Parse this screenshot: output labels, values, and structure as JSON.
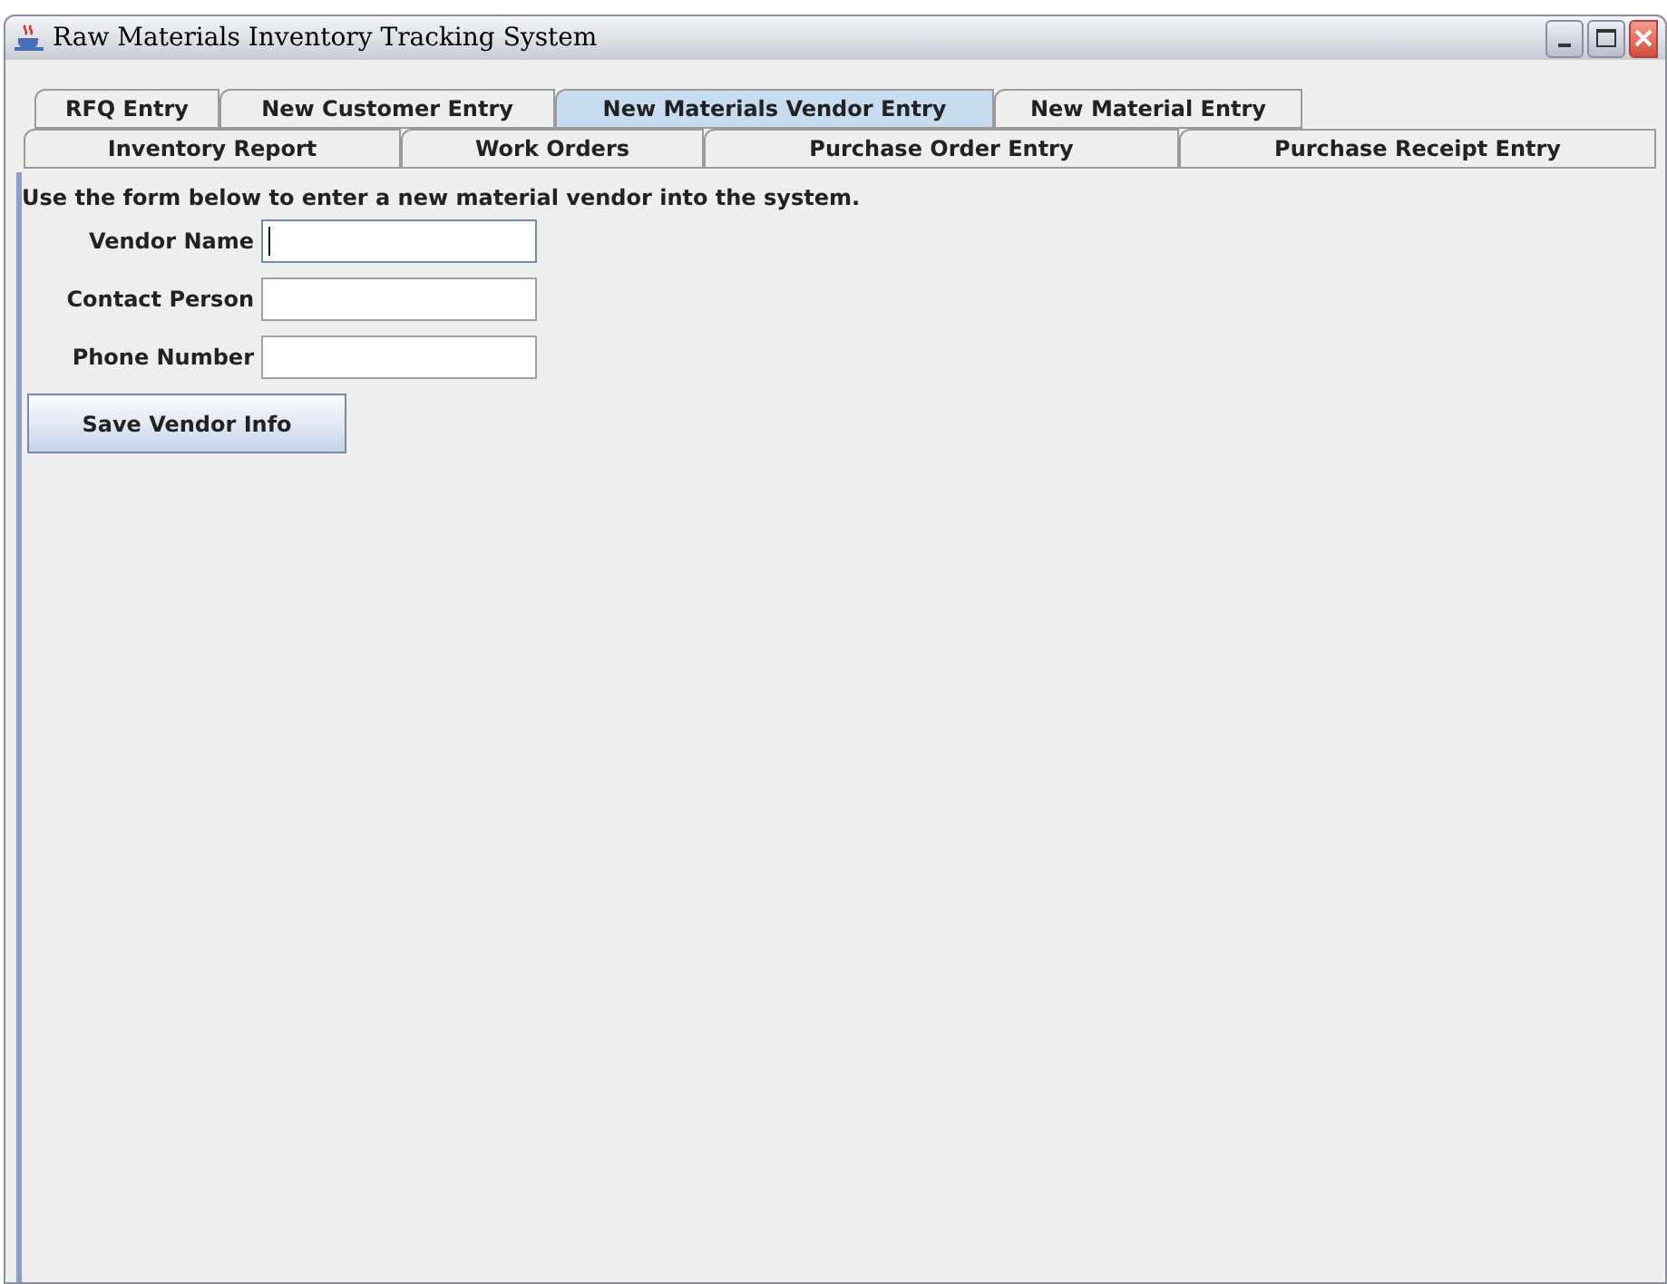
{
  "window": {
    "title": "Raw Materials Inventory Tracking System"
  },
  "tab_rows": [
    {
      "tabs": [
        {
          "label": "RFQ Entry",
          "selected": false
        },
        {
          "label": "New Customer Entry",
          "selected": false
        },
        {
          "label": "New Materials Vendor Entry",
          "selected": true
        },
        {
          "label": "New Material Entry",
          "selected": false
        }
      ]
    },
    {
      "tabs": [
        {
          "label": "Inventory Report",
          "selected": false
        },
        {
          "label": "Work Orders",
          "selected": false
        },
        {
          "label": "Purchase Order Entry",
          "selected": false
        },
        {
          "label": "Purchase Receipt Entry",
          "selected": false
        }
      ]
    }
  ],
  "instructions": "Use the form below to enter a new material vendor into the system.",
  "fields": [
    {
      "label": "Vendor Name",
      "focused": true
    },
    {
      "label": "Contact Person",
      "focused": false
    },
    {
      "label": "Phone Number",
      "focused": false
    }
  ],
  "button": "Save Vendor Info"
}
